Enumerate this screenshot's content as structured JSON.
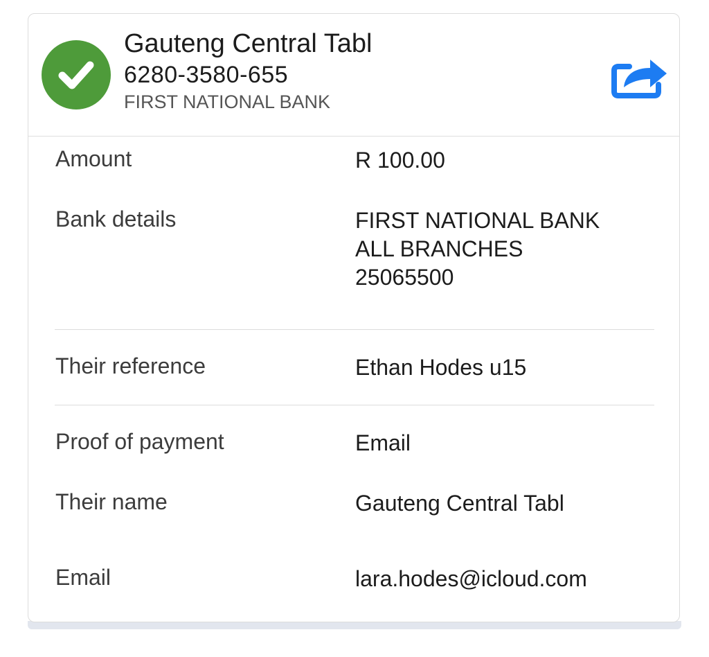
{
  "header": {
    "title": "Gauteng Central Tabl",
    "account_number": "6280-3580-655",
    "bank_name": "FIRST NATIONAL BANK",
    "status_icon": "check-circle-icon",
    "share_icon": "share-icon",
    "colors": {
      "status_green": "#4e9b3a",
      "share_blue": "#1d7cf2"
    }
  },
  "details": {
    "amount": {
      "label": "Amount",
      "value": "R 100.00"
    },
    "bank_details": {
      "label": "Bank details",
      "line1": "FIRST NATIONAL BANK",
      "line2": "ALL BRANCHES",
      "line3": "25065500"
    },
    "their_reference": {
      "label": "Their reference",
      "value": "Ethan Hodes u15"
    },
    "proof_of_payment": {
      "label": "Proof of payment",
      "value": "Email"
    },
    "their_name": {
      "label": "Their name",
      "value": "Gauteng Central Tabl"
    },
    "email": {
      "label": "Email",
      "value": "lara.hodes@icloud.com"
    }
  }
}
